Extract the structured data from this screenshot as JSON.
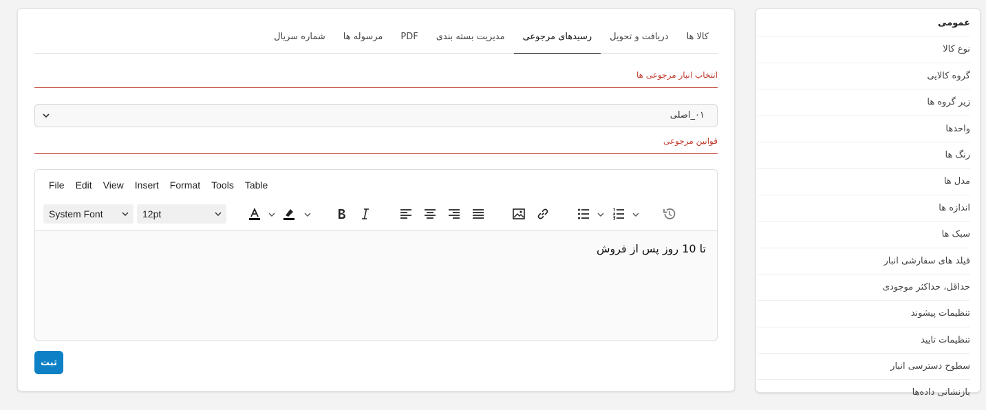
{
  "sidebar": {
    "items": [
      {
        "label": "عمومی",
        "active": true
      },
      {
        "label": "نوع کالا"
      },
      {
        "label": "گروه کالایی"
      },
      {
        "label": "زیر گروه ها"
      },
      {
        "label": "واحدها"
      },
      {
        "label": "رنگ ها"
      },
      {
        "label": "مدل ها"
      },
      {
        "label": "اندازه ها"
      },
      {
        "label": "سبک ها"
      },
      {
        "label": "فیلد های سفارشی انبار"
      },
      {
        "label": "حداقل، حداکثر موجودی"
      },
      {
        "label": "تنظیمات پیشوند"
      },
      {
        "label": "تنظیمات تایید"
      },
      {
        "label": "سطوح دسترسی انبار"
      },
      {
        "label": "بازنشانی داده‌ها"
      }
    ]
  },
  "tabs": [
    {
      "label": "کالا ها"
    },
    {
      "label": "دریافت و تحویل"
    },
    {
      "label": "رسیدهای مرجوعی",
      "active": true
    },
    {
      "label": "مدیریت بسته بندی"
    },
    {
      "label": "PDF"
    },
    {
      "label": "مرسوله ها"
    },
    {
      "label": "شماره سریال"
    }
  ],
  "warehouse_section": {
    "title": "انتخاب انبار مرجوعی ها",
    "selected": "۰۱_اصلی"
  },
  "rules_section": {
    "title": "قوانین مرجوعی"
  },
  "editor": {
    "menu": {
      "file": "File",
      "edit": "Edit",
      "view": "View",
      "insert": "Insert",
      "format": "Format",
      "tools": "Tools",
      "table": "Table"
    },
    "font_family": "System Font",
    "font_size": "12pt",
    "content": "تا 10 روز پس از فروش"
  },
  "submit_label": "ثبت",
  "colors": {
    "accent": "#0e81c6",
    "section_red": "#c0392b"
  }
}
